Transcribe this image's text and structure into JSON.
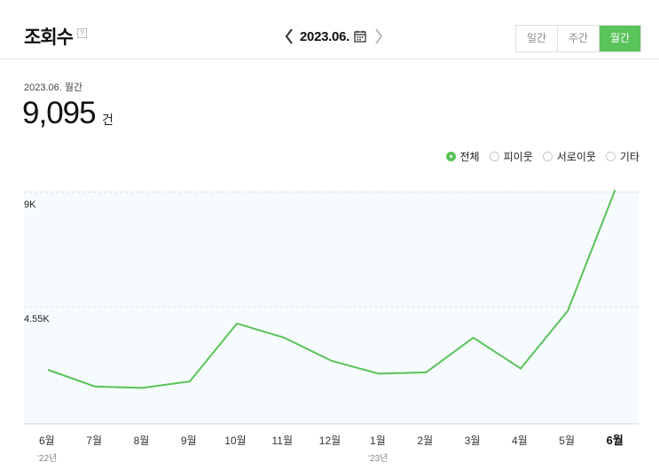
{
  "header": {
    "title": "조회수",
    "help_icon": "?",
    "date": "2023.06.",
    "prev_icon": "chevron-left-icon",
    "next_icon": "chevron-right-icon",
    "calendar_icon": "calendar-icon",
    "tabs": [
      {
        "label": "일간",
        "active": false
      },
      {
        "label": "주간",
        "active": false
      },
      {
        "label": "월간",
        "active": true
      }
    ]
  },
  "summary": {
    "period": "2023.06. 월간",
    "value": "9,095",
    "unit": "건"
  },
  "legend": {
    "options": [
      {
        "label": "전체",
        "selected": true
      },
      {
        "label": "피이웃",
        "selected": false
      },
      {
        "label": "서로이웃",
        "selected": false
      },
      {
        "label": "기타",
        "selected": false
      }
    ]
  },
  "colors": {
    "accent": "#5ac35a",
    "chart_bg": "#f6fbfd",
    "gridline": "#d9dde0"
  },
  "chart_data": {
    "type": "line",
    "categories": [
      "6월",
      "7월",
      "8월",
      "9월",
      "10월",
      "11월",
      "12월",
      "1월",
      "2월",
      "3월",
      "4월",
      "5월",
      "6월"
    ],
    "year_labels": [
      {
        "index": 0,
        "label": "'22년"
      },
      {
        "index": 7,
        "label": "'23년"
      }
    ],
    "highlight_index": 12,
    "series": [
      {
        "values": [
          2100,
          1450,
          1400,
          1650,
          3900,
          3350,
          2450,
          1950,
          2000,
          3350,
          2150,
          4400,
          9095
        ]
      }
    ],
    "yticks": [
      {
        "value": 9000,
        "label": "9K"
      },
      {
        "value": 4550,
        "label": "4.55K"
      }
    ],
    "ylim": [
      0,
      9095
    ],
    "xlabel": "",
    "ylabel": "",
    "grid": true
  }
}
